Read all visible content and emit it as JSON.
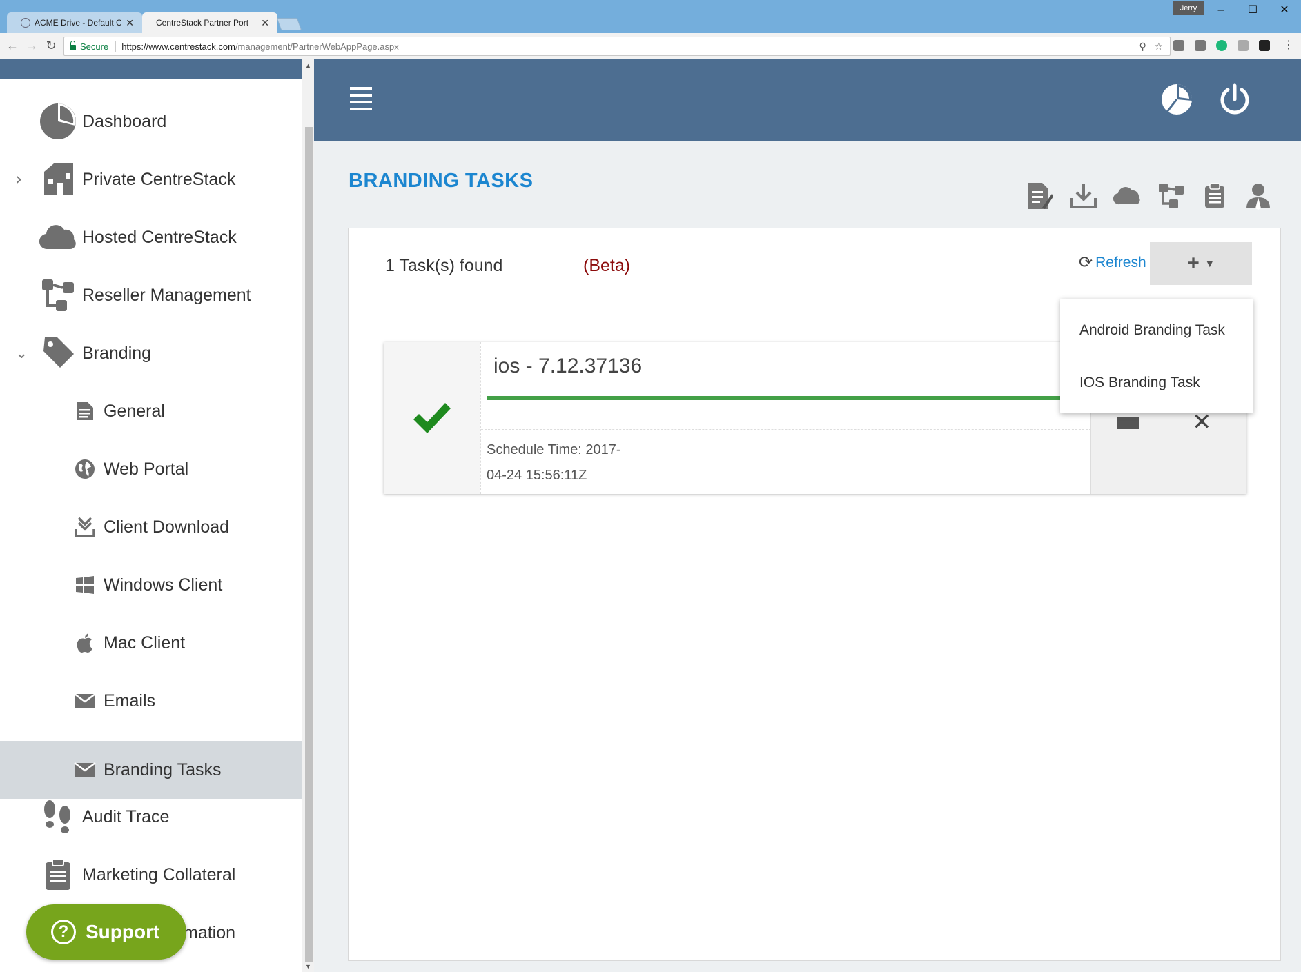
{
  "browser": {
    "tabs": [
      {
        "title": "ACME Drive - Default Cli",
        "active": false
      },
      {
        "title": "CentreStack Partner Port",
        "active": true
      }
    ],
    "user": "Jerry",
    "window_controls": {
      "minimize": "–",
      "maximize": "☐",
      "close": "✕"
    },
    "secure_label": "Secure",
    "url_host": "https://www.centrestack.com",
    "url_path": "/management/PartnerWebAppPage.aspx"
  },
  "sidebar": {
    "items": [
      {
        "label": "Dashboard",
        "icon": "pie-chart-icon"
      },
      {
        "label": "Private CentreStack",
        "icon": "building-icon",
        "chevron": "›"
      },
      {
        "label": "Hosted CentreStack",
        "icon": "cloud-icon"
      },
      {
        "label": "Reseller Management",
        "icon": "network-icon"
      },
      {
        "label": "Branding",
        "icon": "tag-icon",
        "chevron": "⌄"
      },
      {
        "label": "General",
        "icon": "document-icon"
      },
      {
        "label": "Web Portal",
        "icon": "globe-icon"
      },
      {
        "label": "Client Download",
        "icon": "download-icon"
      },
      {
        "label": "Windows Client",
        "icon": "windows-icon"
      },
      {
        "label": "Mac Client",
        "icon": "apple-icon"
      },
      {
        "label": "Emails",
        "icon": "envelope-icon"
      },
      {
        "label": "Branding Tasks",
        "icon": "envelope-icon",
        "selected": true
      },
      {
        "label": "Audit Trace",
        "icon": "footprints-icon"
      },
      {
        "label": "Marketing Collateral",
        "icon": "clipboard-icon"
      },
      {
        "label": "mation",
        "icon": "info-icon"
      }
    ],
    "support_label": "Support"
  },
  "main": {
    "title": "BRANDING TASKS",
    "task_count": "1 Task(s) found",
    "beta": "(Beta)",
    "refresh_label": "Refresh",
    "add_button": "+",
    "tasks": [
      {
        "name": "ios - 7.12.37136",
        "status": "completed",
        "progress": 1.0,
        "schedule_line1": "Schedule Time: 2017-",
        "schedule_line2": "04-24 15:56:11Z"
      }
    ],
    "dropdown": [
      "Android Branding Task",
      "IOS Branding Task"
    ]
  },
  "colors": {
    "header": "#4d6e91",
    "accent": "#1c86d0",
    "beta": "#8b0a0a",
    "progress": "#43a047",
    "check": "#1e8a1e",
    "support": "#77a51c"
  }
}
